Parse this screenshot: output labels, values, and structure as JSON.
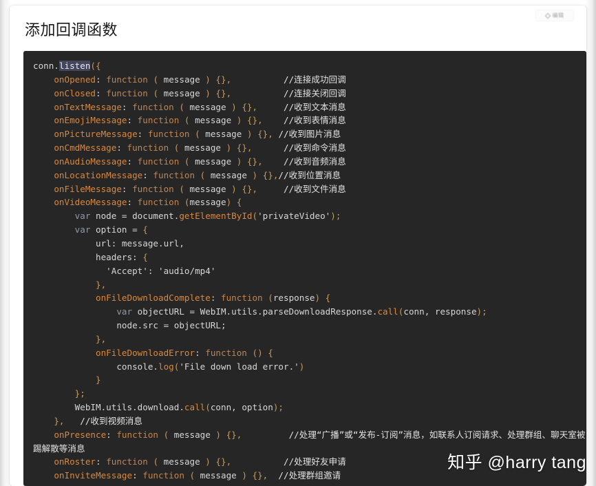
{
  "page": {
    "title": "添加回调函数",
    "watermark": "知乎 @harry tang"
  },
  "edit_chip": {
    "icon": "pencil-icon",
    "label": "编辑"
  },
  "code_block": {
    "language": "javascript",
    "background_color": "#262626",
    "selection": {
      "text": "listen",
      "color": "#44475a"
    },
    "colors": {
      "property": "#d9883f",
      "keyword": "#c08552",
      "var_keyword": "#8f9aa6",
      "plain": "#d7d7d7",
      "punctuation": "#c79a5e",
      "comment": "#e2e2e2"
    },
    "lines": [
      {
        "indent": 0,
        "tokens": [
          {
            "t": "plain",
            "v": "conn."
          },
          {
            "t": "sel",
            "v": "listen"
          },
          {
            "t": "punc",
            "v": "({"
          }
        ]
      },
      {
        "indent": 1,
        "tokens": [
          {
            "t": "prop",
            "v": "onOpened"
          },
          {
            "t": "plain",
            "v": ": "
          },
          {
            "t": "kw",
            "v": "function"
          },
          {
            "t": "punc",
            "v": " ( "
          },
          {
            "t": "plain",
            "v": "message"
          },
          {
            "t": "punc",
            "v": " ) {},"
          },
          {
            "t": "pad",
            "v": "          "
          },
          {
            "t": "cmt",
            "v": "//连接成功回调"
          }
        ]
      },
      {
        "indent": 1,
        "tokens": [
          {
            "t": "prop",
            "v": "onClosed"
          },
          {
            "t": "plain",
            "v": ": "
          },
          {
            "t": "kw",
            "v": "function"
          },
          {
            "t": "punc",
            "v": " ( "
          },
          {
            "t": "plain",
            "v": "message"
          },
          {
            "t": "punc",
            "v": " ) {},"
          },
          {
            "t": "pad",
            "v": "          "
          },
          {
            "t": "cmt",
            "v": "//连接关闭回调"
          }
        ]
      },
      {
        "indent": 1,
        "tokens": [
          {
            "t": "prop",
            "v": "onTextMessage"
          },
          {
            "t": "plain",
            "v": ": "
          },
          {
            "t": "kw",
            "v": "function"
          },
          {
            "t": "punc",
            "v": " ( "
          },
          {
            "t": "plain",
            "v": "message"
          },
          {
            "t": "punc",
            "v": " ) {},"
          },
          {
            "t": "pad",
            "v": "     "
          },
          {
            "t": "cmt",
            "v": "//收到文本消息"
          }
        ]
      },
      {
        "indent": 1,
        "tokens": [
          {
            "t": "prop",
            "v": "onEmojiMessage"
          },
          {
            "t": "plain",
            "v": ": "
          },
          {
            "t": "kw",
            "v": "function"
          },
          {
            "t": "punc",
            "v": " ( "
          },
          {
            "t": "plain",
            "v": "message"
          },
          {
            "t": "punc",
            "v": " ) {},"
          },
          {
            "t": "pad",
            "v": "    "
          },
          {
            "t": "cmt",
            "v": "//收到表情消息"
          }
        ]
      },
      {
        "indent": 1,
        "tokens": [
          {
            "t": "prop",
            "v": "onPictureMessage"
          },
          {
            "t": "plain",
            "v": ": "
          },
          {
            "t": "kw",
            "v": "function"
          },
          {
            "t": "punc",
            "v": " ( "
          },
          {
            "t": "plain",
            "v": "message"
          },
          {
            "t": "punc",
            "v": " ) {},"
          },
          {
            "t": "pad",
            "v": " "
          },
          {
            "t": "cmt",
            "v": "//收到图片消息"
          }
        ]
      },
      {
        "indent": 1,
        "tokens": [
          {
            "t": "prop",
            "v": "onCmdMessage"
          },
          {
            "t": "plain",
            "v": ": "
          },
          {
            "t": "kw",
            "v": "function"
          },
          {
            "t": "punc",
            "v": " ( "
          },
          {
            "t": "plain",
            "v": "message"
          },
          {
            "t": "punc",
            "v": " ) {},"
          },
          {
            "t": "pad",
            "v": "      "
          },
          {
            "t": "cmt",
            "v": "//收到命令消息"
          }
        ]
      },
      {
        "indent": 1,
        "tokens": [
          {
            "t": "prop",
            "v": "onAudioMessage"
          },
          {
            "t": "plain",
            "v": ": "
          },
          {
            "t": "kw",
            "v": "function"
          },
          {
            "t": "punc",
            "v": " ( "
          },
          {
            "t": "plain",
            "v": "message"
          },
          {
            "t": "punc",
            "v": " ) {},"
          },
          {
            "t": "pad",
            "v": "    "
          },
          {
            "t": "cmt",
            "v": "//收到音频消息"
          }
        ]
      },
      {
        "indent": 1,
        "tokens": [
          {
            "t": "prop",
            "v": "onLocationMessage"
          },
          {
            "t": "plain",
            "v": ": "
          },
          {
            "t": "kw",
            "v": "function"
          },
          {
            "t": "punc",
            "v": " ( "
          },
          {
            "t": "plain",
            "v": "message"
          },
          {
            "t": "punc",
            "v": " ) {},"
          },
          {
            "t": "cmt",
            "v": "//收到位置消息"
          }
        ]
      },
      {
        "indent": 1,
        "tokens": [
          {
            "t": "prop",
            "v": "onFileMessage"
          },
          {
            "t": "plain",
            "v": ": "
          },
          {
            "t": "kw",
            "v": "function"
          },
          {
            "t": "punc",
            "v": " ( "
          },
          {
            "t": "plain",
            "v": "message"
          },
          {
            "t": "punc",
            "v": " ) {},"
          },
          {
            "t": "pad",
            "v": "     "
          },
          {
            "t": "cmt",
            "v": "//收到文件消息"
          }
        ]
      },
      {
        "indent": 1,
        "tokens": [
          {
            "t": "prop",
            "v": "onVideoMessage"
          },
          {
            "t": "plain",
            "v": ": "
          },
          {
            "t": "kw",
            "v": "function"
          },
          {
            "t": "punc",
            "v": " ("
          },
          {
            "t": "plain",
            "v": "message"
          },
          {
            "t": "punc",
            "v": ") {"
          }
        ]
      },
      {
        "indent": 2,
        "tokens": [
          {
            "t": "var",
            "v": "var"
          },
          {
            "t": "plain",
            "v": " node = document."
          },
          {
            "t": "fn",
            "v": "getElementById"
          },
          {
            "t": "punc",
            "v": "("
          },
          {
            "t": "str",
            "v": "'privateVideo'"
          },
          {
            "t": "punc",
            "v": ");"
          }
        ]
      },
      {
        "indent": 2,
        "tokens": [
          {
            "t": "var",
            "v": "var"
          },
          {
            "t": "plain",
            "v": " option = "
          },
          {
            "t": "punc",
            "v": "{"
          }
        ]
      },
      {
        "indent": 3,
        "tokens": [
          {
            "t": "plain",
            "v": "url: message.url,"
          }
        ]
      },
      {
        "indent": 3,
        "tokens": [
          {
            "t": "plain",
            "v": "headers: "
          },
          {
            "t": "punc",
            "v": "{"
          }
        ]
      },
      {
        "indent": 3,
        "extra": 2,
        "tokens": [
          {
            "t": "str",
            "v": "'Accept'"
          },
          {
            "t": "plain",
            "v": ": "
          },
          {
            "t": "str",
            "v": "'audio/mp4'"
          }
        ]
      },
      {
        "indent": 3,
        "tokens": [
          {
            "t": "punc",
            "v": "},"
          }
        ]
      },
      {
        "indent": 3,
        "tokens": [
          {
            "t": "prop",
            "v": "onFileDownloadComplete"
          },
          {
            "t": "plain",
            "v": ": "
          },
          {
            "t": "kw",
            "v": "function"
          },
          {
            "t": "punc",
            "v": " ("
          },
          {
            "t": "plain",
            "v": "response"
          },
          {
            "t": "punc",
            "v": ") {"
          }
        ]
      },
      {
        "indent": 4,
        "tokens": [
          {
            "t": "var",
            "v": "var"
          },
          {
            "t": "plain",
            "v": " objectURL = WebIM.utils.parseDownloadResponse."
          },
          {
            "t": "fn",
            "v": "call"
          },
          {
            "t": "punc",
            "v": "("
          },
          {
            "t": "plain",
            "v": "conn, response"
          },
          {
            "t": "punc",
            "v": ");"
          }
        ]
      },
      {
        "indent": 4,
        "tokens": [
          {
            "t": "plain",
            "v": "node.src = objectURL;"
          }
        ]
      },
      {
        "indent": 3,
        "tokens": [
          {
            "t": "punc",
            "v": "},"
          }
        ]
      },
      {
        "indent": 3,
        "tokens": [
          {
            "t": "prop",
            "v": "onFileDownloadError"
          },
          {
            "t": "plain",
            "v": ": "
          },
          {
            "t": "kw",
            "v": "function"
          },
          {
            "t": "punc",
            "v": " () {"
          }
        ]
      },
      {
        "indent": 4,
        "tokens": [
          {
            "t": "plain",
            "v": "console."
          },
          {
            "t": "fn",
            "v": "log"
          },
          {
            "t": "punc",
            "v": "("
          },
          {
            "t": "str",
            "v": "'File down load error.'"
          },
          {
            "t": "punc",
            "v": ")"
          }
        ]
      },
      {
        "indent": 3,
        "tokens": [
          {
            "t": "punc",
            "v": "}"
          }
        ]
      },
      {
        "indent": 2,
        "tokens": [
          {
            "t": "punc",
            "v": "};"
          }
        ]
      },
      {
        "indent": 2,
        "tokens": [
          {
            "t": "plain",
            "v": "WebIM.utils.download."
          },
          {
            "t": "fn",
            "v": "call"
          },
          {
            "t": "punc",
            "v": "("
          },
          {
            "t": "plain",
            "v": "conn, option"
          },
          {
            "t": "punc",
            "v": ");"
          }
        ]
      },
      {
        "indent": 1,
        "tokens": [
          {
            "t": "punc",
            "v": "},"
          },
          {
            "t": "pad",
            "v": "   "
          },
          {
            "t": "cmt",
            "v": "//收到视频消息"
          }
        ]
      },
      {
        "indent": 1,
        "tokens": [
          {
            "t": "prop",
            "v": "onPresence"
          },
          {
            "t": "plain",
            "v": ": "
          },
          {
            "t": "kw",
            "v": "function"
          },
          {
            "t": "punc",
            "v": " ( "
          },
          {
            "t": "plain",
            "v": "message"
          },
          {
            "t": "punc",
            "v": " ) {},"
          },
          {
            "t": "pad",
            "v": "         "
          },
          {
            "t": "cmt",
            "v": "//处理“广播”或“发布-订阅”消息，如联系人订阅请求、处理群组、聊天室被踢解散等消息"
          }
        ]
      },
      {
        "indent": 1,
        "tokens": [
          {
            "t": "prop",
            "v": "onRoster"
          },
          {
            "t": "plain",
            "v": ": "
          },
          {
            "t": "kw",
            "v": "function"
          },
          {
            "t": "punc",
            "v": " ( "
          },
          {
            "t": "plain",
            "v": "message"
          },
          {
            "t": "punc",
            "v": " ) {},"
          },
          {
            "t": "pad",
            "v": "          "
          },
          {
            "t": "cmt",
            "v": "//处理好友申请"
          }
        ]
      },
      {
        "indent": 1,
        "tokens": [
          {
            "t": "prop",
            "v": "onInviteMessage"
          },
          {
            "t": "plain",
            "v": ": "
          },
          {
            "t": "kw",
            "v": "function"
          },
          {
            "t": "punc",
            "v": " ( "
          },
          {
            "t": "plain",
            "v": "message"
          },
          {
            "t": "punc",
            "v": " ) {},"
          },
          {
            "t": "pad",
            "v": "  "
          },
          {
            "t": "cmt",
            "v": "//处理群组邀请"
          }
        ]
      }
    ]
  }
}
